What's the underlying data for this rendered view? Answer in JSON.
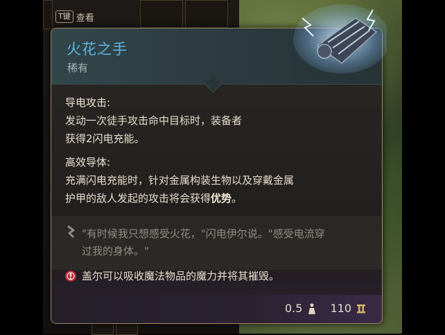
{
  "hint": {
    "key": "T键",
    "label": "查看"
  },
  "item": {
    "name": "火花之手",
    "rarity": "稀有"
  },
  "sections": [
    {
      "title": "导电攻击:",
      "lines": [
        "发动一次徒手攻击命中目标时，装备者",
        "获得2闪电充能。"
      ]
    },
    {
      "title": "高效导体:",
      "lines": [
        "充满闪电充能时，针对金属构装生物以及穿戴金属",
        "护甲的敌人发起的攻击将会获得",
        "优势",
        "。"
      ]
    }
  ],
  "quote": {
    "line1": "\"有时候我只想感受火花，\"闪电伊尔说。\"感受电流穿",
    "line2": "过我的身体。\""
  },
  "note": "盖尔可以吸收魔法物品的魔力并将其摧毁。",
  "footer": {
    "weight": "0.5",
    "value": "110"
  },
  "colors": {
    "name": "#5fb6e4",
    "border": "#9c8a62",
    "note_icon": "#c0263a"
  },
  "icons": [
    "quote-mark-icon",
    "gale-warning-icon",
    "weight-icon",
    "gold-value-icon",
    "gauntlet-item-icon"
  ]
}
